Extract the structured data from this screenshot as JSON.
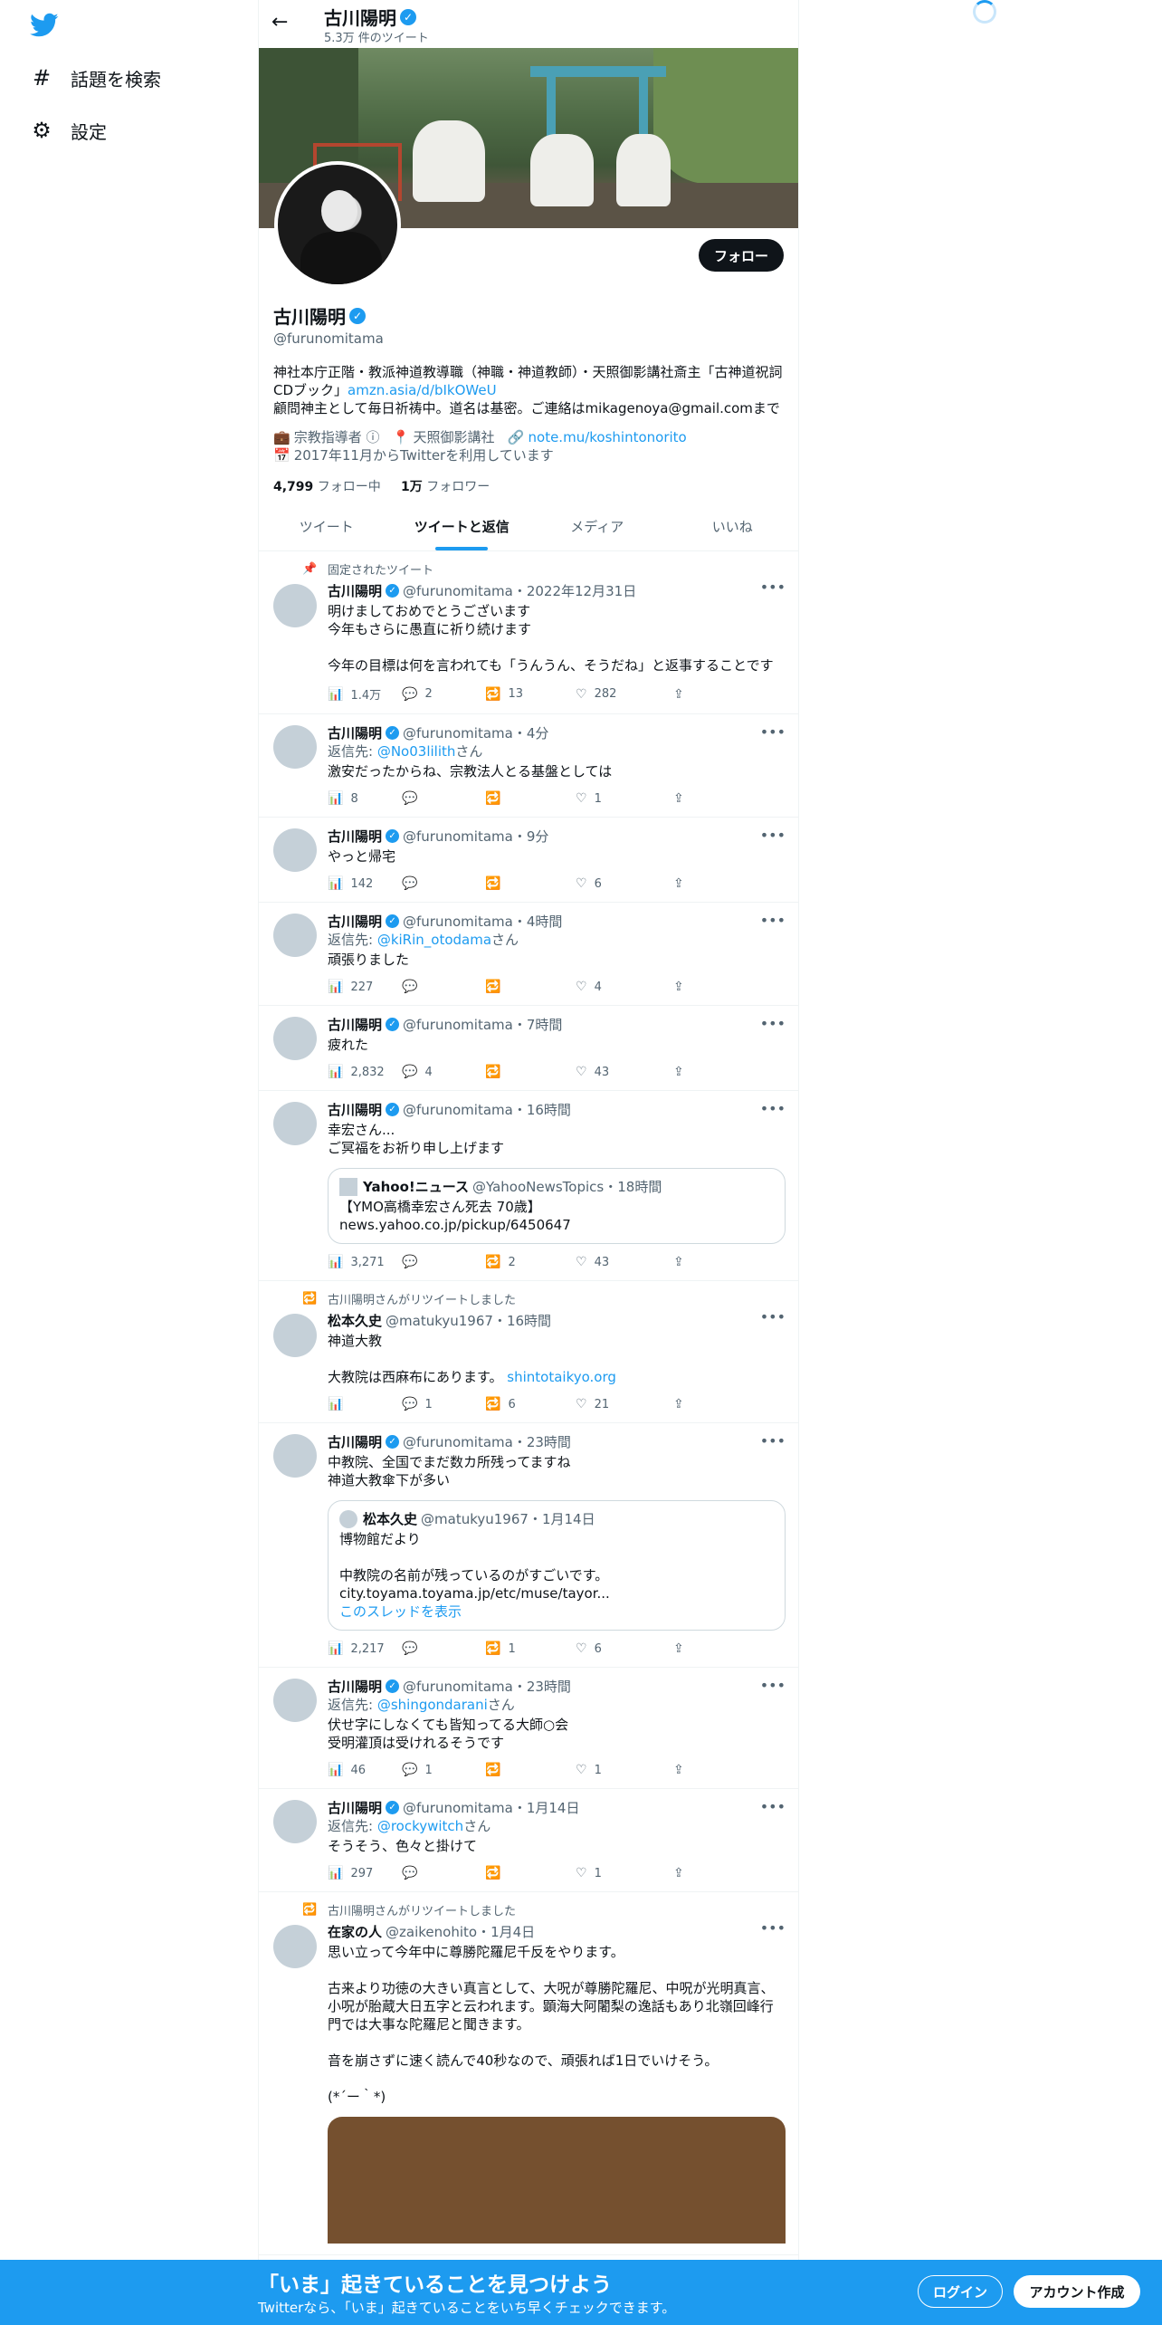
{
  "nav": {
    "explore_label": "話題を検索",
    "settings_label": "設定"
  },
  "header": {
    "name": "古川陽明",
    "tweet_count": "5.3万 件のツイート"
  },
  "profile": {
    "follow_label": "フォロー",
    "name": "古川陽明",
    "handle": "@furunomitama",
    "bio_line1": "神社本庁正階・教派神道教導職（神職・神道教師）・天照御影講社斎主「古神道祝詞CDブック」",
    "bio_link": "amzn.asia/d/bIkOWeU",
    "bio_line2": "顧問神主として毎日祈祷中。道名は基密。ご連絡はmikagenoya@gmail.comまで",
    "category": "宗教指導者",
    "location": "天照御影講社",
    "website": "note.mu/koshintonorito",
    "joined": "2017年11月からTwitterを利用しています",
    "following_count": "4,799",
    "following_label": "フォロー中",
    "followers_count": "1万",
    "followers_label": "フォロワー"
  },
  "tabs": [
    {
      "label": "ツイート"
    },
    {
      "label": "ツイートと返信"
    },
    {
      "label": "メディア"
    },
    {
      "label": "いいね"
    }
  ],
  "tweets": [
    {
      "social": "固定されたツイート",
      "name": "古川陽明",
      "handle": "@furunomitama",
      "time": "2022年12月31日",
      "text": "明けましておめでとうございます\n今年もさらに愚直に祈り続けます\n\n今年の目標は何を言われても「うんうん、そうだね」と返事することです",
      "views": "1.4万",
      "replies": "2",
      "retweets": "13",
      "likes": "282"
    },
    {
      "name": "古川陽明",
      "handle": "@furunomitama",
      "time": "4分",
      "reply_prefix": "返信先: ",
      "reply_to": "@No03lilith",
      "reply_suffix": "さん",
      "text": "激安だったからね、宗教法人とる基盤としては",
      "views": "8",
      "replies": "",
      "retweets": "",
      "likes": "1"
    },
    {
      "name": "古川陽明",
      "handle": "@furunomitama",
      "time": "9分",
      "text": "やっと帰宅",
      "views": "142",
      "replies": "",
      "retweets": "",
      "likes": "6"
    },
    {
      "name": "古川陽明",
      "handle": "@furunomitama",
      "time": "4時間",
      "reply_prefix": "返信先: ",
      "reply_to": "@kiRin_otodama",
      "reply_suffix": "さん",
      "text": "頑張りました",
      "views": "227",
      "replies": "",
      "retweets": "",
      "likes": "4"
    },
    {
      "name": "古川陽明",
      "handle": "@furunomitama",
      "time": "7時間",
      "text": "疲れた",
      "views": "2,832",
      "replies": "4",
      "retweets": "",
      "likes": "43"
    },
    {
      "name": "古川陽明",
      "handle": "@furunomitama",
      "time": "16時間",
      "text": "幸宏さん...\nご冥福をお祈り申し上げます",
      "quote": {
        "name": "Yahoo!ニュース",
        "handle": "@YahooNewsTopics",
        "time": "18時間",
        "text": "【YMO高橋幸宏さん死去 70歳】\nnews.yahoo.co.jp/pickup/6450647"
      },
      "views": "3,271",
      "replies": "",
      "retweets": "2",
      "likes": "43"
    },
    {
      "social": "古川陽明さんがリツイートしました",
      "name": "松本久史",
      "handle": "@matukyu1967",
      "time": "16時間",
      "text": "神道大教\n\n大教院は西麻布にあります。",
      "link": "shintotaikyo.org",
      "views": "",
      "replies": "1",
      "retweets": "6",
      "likes": "21"
    },
    {
      "name": "古川陽明",
      "handle": "@furunomitama",
      "time": "23時間",
      "text": "中教院、全国でまだ数カ所残ってますね\n神道大教傘下が多い",
      "quote": {
        "name": "松本久史",
        "handle": "@matukyu1967",
        "time": "1月14日",
        "text": "博物館だより\n\n中教院の名前が残っているのがすごいです。\ncity.toyama.toyama.jp/etc/muse/tayor...",
        "thread": "このスレッドを表示"
      },
      "views": "2,217",
      "replies": "",
      "retweets": "1",
      "likes": "6"
    },
    {
      "name": "古川陽明",
      "handle": "@furunomitama",
      "time": "23時間",
      "reply_prefix": "返信先: ",
      "reply_to": "@shingondarani",
      "reply_suffix": "さん",
      "text": "伏せ字にしなくても皆知ってる大師○会\n受明灌頂は受けれるそうです",
      "views": "46",
      "replies": "1",
      "retweets": "",
      "likes": "1"
    },
    {
      "name": "古川陽明",
      "handle": "@furunomitama",
      "time": "1月14日",
      "reply_prefix": "返信先: ",
      "reply_to": "@rockywitch",
      "reply_suffix": "さん",
      "text": "そうそう、色々と掛けて",
      "views": "297",
      "replies": "",
      "retweets": "",
      "likes": "1"
    },
    {
      "social": "古川陽明さんがリツイートしました",
      "name": "在家の人",
      "handle": "@zaikenohito",
      "time": "1月4日",
      "text": "思い立って今年中に尊勝陀羅尼千反をやります。\n\n古来より功徳の大きい真言として、大呪が尊勝陀羅尼、中呪が光明真言、小呪が胎蔵大日五字と云われます。顕海大阿闍梨の逸話もあり北嶺回峰行門では大事な陀羅尼と聞きます。\n\n音を崩さずに速く読んで40秒なので、頑張れば1日でいけそう。\n\n(*´ー｀*)"
    }
  ],
  "bottom_bar": {
    "title": "「いま」起きていることを見つけよう",
    "subtitle": "Twitterなら、「いま」起きていることをいち早くチェックできます。",
    "login_label": "ログイン",
    "signup_label": "アカウント作成"
  }
}
